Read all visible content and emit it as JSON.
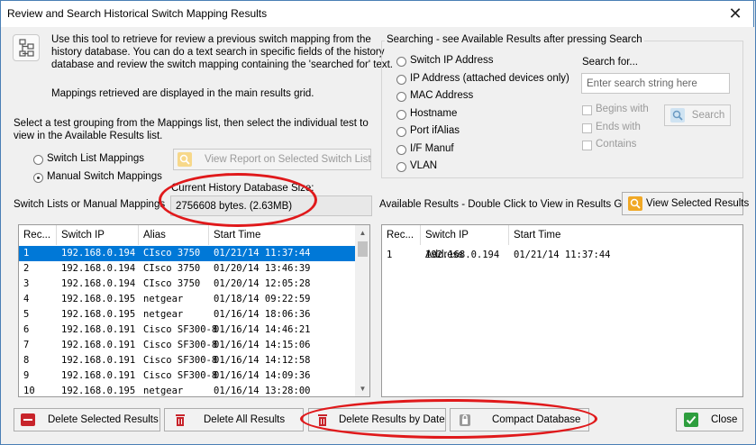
{
  "window": {
    "title": "Review and Search Historical Switch Mapping Results",
    "close": "✕"
  },
  "intro": {
    "line1": "Use this tool to retrieve for review a previous switch mapping from the",
    "line2": "history database. You can do a text search in specific fields of the history",
    "line3": "database and review the switch mapping containing the 'searched for' text.",
    "line4": "Mappings retrieved are displayed in the main results grid."
  },
  "instruction": {
    "line1": "Select a test grouping from the Mappings list, then select the individual test to",
    "line2": "view in the Available Results list."
  },
  "mode": {
    "switch_list": "Switch List Mappings",
    "manual": "Manual Switch Mappings",
    "selected": "manual"
  },
  "view_report_button": "View Report on Selected Switch List",
  "db_size": {
    "label": "Current History Database Size:",
    "value": "2756608 bytes. (2.63MB)"
  },
  "search": {
    "group_label": "Searching - see Available Results after pressing Search",
    "fields": [
      "Switch IP Address",
      "IP Address (attached devices only)",
      "MAC Address",
      "Hostname",
      "Port ifAlias",
      "I/F Manuf",
      "VLAN"
    ],
    "search_for_label": "Search for...",
    "placeholder": "Enter search string here",
    "begins_with": "Begins with",
    "ends_with": "Ends with",
    "contains": "Contains",
    "search_button": "Search"
  },
  "left_list": {
    "label": "Switch Lists or Manual Mappings",
    "columns": [
      "Rec...",
      "Switch IP",
      "Alias",
      "Start Time"
    ],
    "rows": [
      [
        "1",
        "192.168.0.194",
        "CIsco 3750",
        "01/21/14 11:37:44"
      ],
      [
        "2",
        "192.168.0.194",
        "CIsco 3750",
        "01/20/14 13:46:39"
      ],
      [
        "3",
        "192.168.0.194",
        "CIsco 3750",
        "01/20/14 12:05:28"
      ],
      [
        "4",
        "192.168.0.195",
        "netgear",
        "01/18/14 09:22:59"
      ],
      [
        "5",
        "192.168.0.195",
        "netgear",
        "01/16/14 18:06:36"
      ],
      [
        "6",
        "192.168.0.191",
        "Cisco SF300-8",
        "01/16/14 14:46:21"
      ],
      [
        "7",
        "192.168.0.191",
        "Cisco SF300-8",
        "01/16/14 14:15:06"
      ],
      [
        "8",
        "192.168.0.191",
        "Cisco SF300-8",
        "01/16/14 14:12:58"
      ],
      [
        "9",
        "192.168.0.191",
        "Cisco SF300-8",
        "01/16/14 14:09:36"
      ],
      [
        "10",
        "192.168.0.195",
        "netgear",
        "01/16/14 13:28:00"
      ]
    ]
  },
  "right_list": {
    "label": "Available Results - Double Click to View in Results Grid",
    "view_button": "View Selected Results",
    "columns": [
      "Rec...",
      "Switch IP Address",
      "Start Time"
    ],
    "rows": [
      [
        "1",
        "192.168.0.194",
        "01/21/14 11:37:44"
      ]
    ]
  },
  "buttons": {
    "delete_selected": "Delete Selected Results",
    "delete_all": "Delete All Results",
    "delete_by_date": "Delete Results by Date",
    "compact": "Compact Database",
    "close": "Close"
  },
  "colors": {
    "selection": "#0078d7",
    "annotation": "#e0191b",
    "delete_red": "#c8242b",
    "ok_green": "#2e9e3e"
  }
}
